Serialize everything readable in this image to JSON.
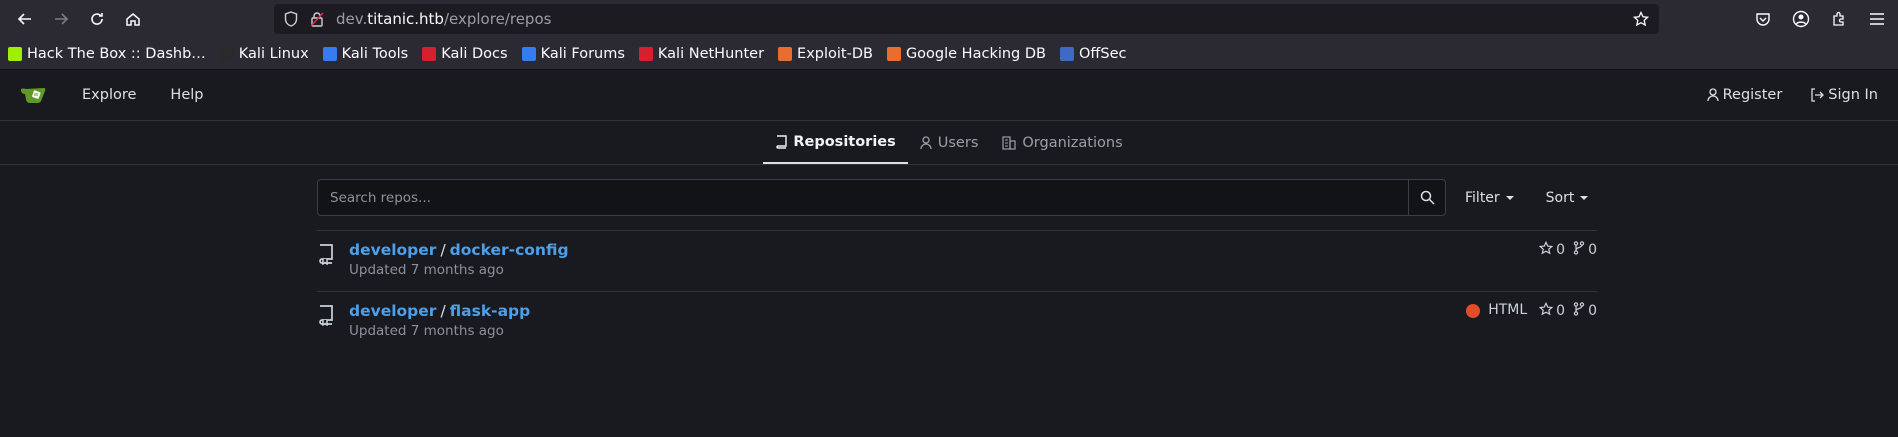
{
  "browser": {
    "url_prefix": "dev.",
    "url_host": "titanic.htb",
    "url_path": "/explore/repos",
    "bookmarks": [
      {
        "label": "Hack The Box :: Dashb…",
        "color": "#9fef00"
      },
      {
        "label": "Kali Linux",
        "color": "#2a2a2a"
      },
      {
        "label": "Kali Tools",
        "color": "#367bf0"
      },
      {
        "label": "Kali Docs",
        "color": "#d6202f"
      },
      {
        "label": "Kali Forums",
        "color": "#367bf0"
      },
      {
        "label": "Kali NetHunter",
        "color": "#d6202f"
      },
      {
        "label": "Exploit-DB",
        "color": "#e86d2f"
      },
      {
        "label": "Google Hacking DB",
        "color": "#e86d2f"
      },
      {
        "label": "OffSec",
        "color": "#4069c6"
      }
    ]
  },
  "nav": {
    "explore": "Explore",
    "help": "Help",
    "register": "Register",
    "sign_in": "Sign In"
  },
  "tabs": {
    "repositories": "Repositories",
    "users": "Users",
    "organizations": "Organizations"
  },
  "search": {
    "placeholder": "Search repos...",
    "filter": "Filter",
    "sort": "Sort"
  },
  "repos": [
    {
      "owner": "developer",
      "name": "docker-config",
      "updated": "Updated 7 months ago",
      "language": "",
      "stars": "0",
      "forks": "0"
    },
    {
      "owner": "developer",
      "name": "flask-app",
      "updated": "Updated 7 months ago",
      "language": "HTML",
      "language_color": "#e34c26",
      "stars": "0",
      "forks": "0"
    }
  ],
  "colors": {
    "accent_link": "#4f9fe8",
    "background": "#181a1f"
  }
}
